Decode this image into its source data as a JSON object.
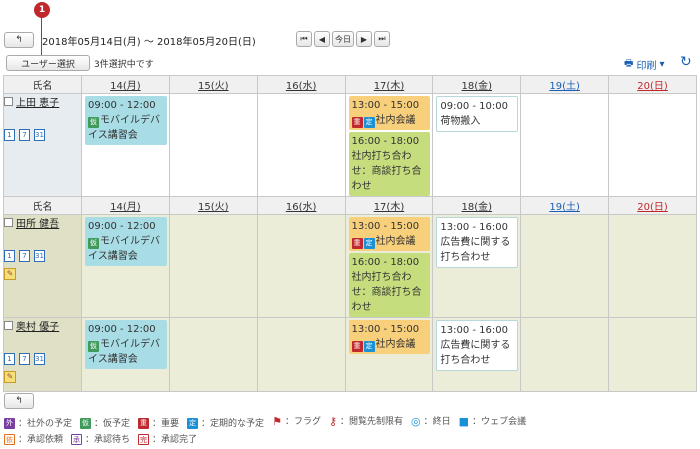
{
  "marker": {
    "number": "1"
  },
  "toolbar": {
    "back_icon": "back-arrow-icon",
    "date_range": "2018年05月14日(月) 〜 2018年05月20日(日)",
    "nav": {
      "first": "⏮",
      "prev": "◀",
      "today": "今日",
      "next": "▶",
      "last": "⏭"
    },
    "user_select_label": "ユーザー選択",
    "selected_text": "3件選択中です",
    "print_label": "印刷",
    "refresh_icon": "refresh-icon"
  },
  "table": {
    "name_header": "氏名",
    "days": [
      "14(月)",
      "15(火)",
      "16(水)",
      "17(木)",
      "18(金)",
      "19(土)",
      "20(日)"
    ],
    "users": [
      {
        "name": "上田 恵子",
        "events": {
          "mon": [
            {
              "time": "09:00 - 12:00",
              "tags": [
                "仮"
              ],
              "title": "モバイルデバイス講習会",
              "color": "teal"
            }
          ],
          "thu": [
            {
              "time": "13:00 - 15:00",
              "tags": [
                "重",
                "定"
              ],
              "title": "社内会議",
              "color": "orange"
            },
            {
              "time": "16:00 - 18:00",
              "tags": [],
              "title": "社内打ち合わせ：商談打ち合わせ",
              "color": "green"
            }
          ],
          "fri": [
            {
              "time": "09:00 - 10:00",
              "tags": [],
              "title": "荷物搬入",
              "color": "white"
            }
          ]
        }
      },
      {
        "name": "田所 健吾",
        "events": {
          "mon": [
            {
              "time": "09:00 - 12:00",
              "tags": [
                "仮"
              ],
              "title": "モバイルデバイス講習会",
              "color": "teal"
            }
          ],
          "thu": [
            {
              "time": "13:00 - 15:00",
              "tags": [
                "重",
                "定"
              ],
              "title": "社内会議",
              "color": "orange"
            },
            {
              "time": "16:00 - 18:00",
              "tags": [],
              "title": "社内打ち合わせ：商談打ち合わせ",
              "color": "green"
            }
          ],
          "fri": [
            {
              "time": "13:00 - 16:00",
              "tags": [],
              "title": "広告費に関する打ち合わせ",
              "color": "white"
            }
          ]
        }
      },
      {
        "name": "奥村 優子",
        "events": {
          "mon": [
            {
              "time": "09:00 - 12:00",
              "tags": [
                "仮"
              ],
              "title": "モバイルデバイス講習会",
              "color": "teal"
            }
          ],
          "thu": [
            {
              "time": "13:00 - 15:00",
              "tags": [
                "重",
                "定"
              ],
              "title": "社内会議",
              "color": "orange"
            }
          ],
          "fri": [
            {
              "time": "13:00 - 16:00",
              "tags": [],
              "title": "広告費に関する打ち合わせ",
              "color": "white"
            }
          ]
        }
      }
    ]
  },
  "legend": {
    "row1": [
      {
        "icon": "外",
        "label": "：社外の予定"
      },
      {
        "icon": "仮",
        "label": "：仮予定"
      },
      {
        "icon": "重",
        "label": "：重要"
      },
      {
        "icon": "定",
        "label": "：定期的な予定"
      },
      {
        "icon": "flag-icon",
        "label": "：フラグ"
      },
      {
        "icon": "key-icon",
        "label": "：閲覧先制限有"
      },
      {
        "icon": "allday-icon",
        "label": "：終日"
      },
      {
        "icon": "video-icon",
        "label": "：ウェブ会議"
      }
    ],
    "row2": [
      {
        "icon": "依",
        "label": "：承認依頼"
      },
      {
        "icon": "承",
        "label": "：承認待ち"
      },
      {
        "icon": "完",
        "label": "：承認完了"
      }
    ]
  }
}
